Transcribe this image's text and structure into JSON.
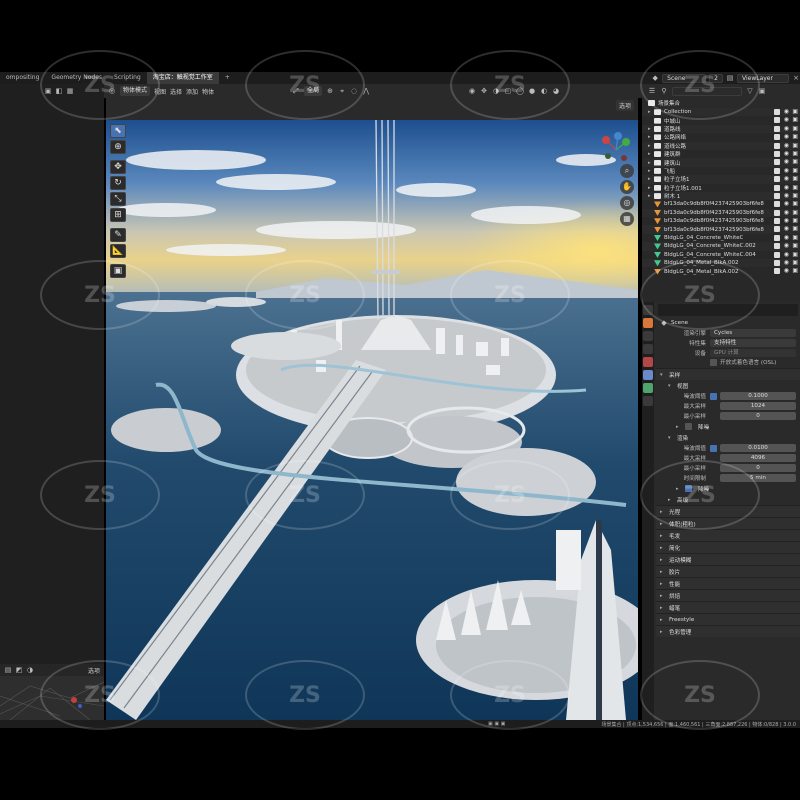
{
  "workspace_tabs": [
    "ompositing",
    "Geometry Nodes",
    "Scripting",
    "淘宝店：触视觉工作室",
    "+"
  ],
  "scene": {
    "label": "Scene",
    "frame": "2",
    "view_layer": "ViewLayer"
  },
  "viewport_header": {
    "mode": "物体模式",
    "menus": [
      "视图",
      "选择",
      "添加",
      "物体"
    ],
    "transform": "全局",
    "options": "选项"
  },
  "left_bottom": {
    "options": "选项"
  },
  "outliner": {
    "root": "场景集合",
    "rows": [
      {
        "label": "Collection",
        "icon": "collection",
        "caret": "▸"
      },
      {
        "label": "中城山",
        "icon": "collection",
        "caret": ""
      },
      {
        "label": "道路线",
        "icon": "collection",
        "caret": "▸"
      },
      {
        "label": "公路网络",
        "icon": "collection",
        "caret": "▸"
      },
      {
        "label": "道线公路",
        "icon": "collection",
        "caret": "▸"
      },
      {
        "label": "建筑群",
        "icon": "collection",
        "caret": "▸"
      },
      {
        "label": "建筑山",
        "icon": "collection",
        "caret": "▸"
      },
      {
        "label": "飞船",
        "icon": "collection",
        "caret": "▸"
      },
      {
        "label": "粒子立场1",
        "icon": "collection",
        "caret": "▸"
      },
      {
        "label": "粒子立场1.001",
        "icon": "collection",
        "caret": "▸"
      },
      {
        "label": "树木 1",
        "icon": "collection",
        "caret": "▸"
      },
      {
        "label": "bf13da0c9db8f0f4237425903bf6fe8d5",
        "icon": "mesh",
        "caret": ""
      },
      {
        "label": "bf13da0c9db8f0f4237425903bf6fe8d5",
        "icon": "mesh",
        "caret": ""
      },
      {
        "label": "bf13da0c9db8f0f4237425903bf6fe8d5",
        "icon": "mesh",
        "caret": ""
      },
      {
        "label": "bf13da0c9db8f0f4237425903bf6fe8d5",
        "icon": "mesh",
        "caret": ""
      },
      {
        "label": "BldgLG_04_Concrete_WhiteC",
        "icon": "mesh-green",
        "caret": ""
      },
      {
        "label": "BldgLG_04_Concrete_WhiteC.002",
        "icon": "mesh-green",
        "caret": ""
      },
      {
        "label": "BldgLG_04_Concrete_WhiteC.004",
        "icon": "mesh-green",
        "caret": ""
      },
      {
        "label": "BldgLG_04_Metal_BlkA.002",
        "icon": "mesh-green",
        "caret": ""
      },
      {
        "label": "BldgLG_04_Metal_BlkA.002",
        "icon": "mesh",
        "caret": ""
      }
    ]
  },
  "properties": {
    "scene": "Scene",
    "render_engine_label": "渲染引擎",
    "render_engine": "Cycles",
    "feature_set_label": "特性集",
    "feature_set": "支持特性",
    "device_label": "设备",
    "device": "GPU 计算",
    "osl_label": "开放式着色语言 (OSL)",
    "sampling": "采样",
    "viewport": "视图",
    "noise_threshold_label": "噪波阈值",
    "viewport_noise_threshold": "0.1000",
    "max_samples_label": "最大采样",
    "viewport_max_samples": "1024",
    "min_samples_label": "最小采样",
    "viewport_min_samples": "0",
    "denoise": "降噪",
    "render": "渲染",
    "render_noise_threshold": "0.0100",
    "render_max_samples": "4096",
    "render_min_samples": "0",
    "time_limit_label": "时间限制",
    "time_limit": "5 min",
    "advanced": "高级",
    "sections": [
      "光程",
      "体积(粗粒)",
      "毛发",
      "简化",
      "运动模糊",
      "胶片",
      "性能",
      "烘焙",
      "蜡笔",
      "Freestyle",
      "色彩管理"
    ]
  },
  "statusbar": {
    "text": "场景集合 | 顶点:1,534,656 | 面:1,460,561 | 三角面:2,887,226 | 物体:0/828 | 3.0.0"
  },
  "watermark": "ZS"
}
